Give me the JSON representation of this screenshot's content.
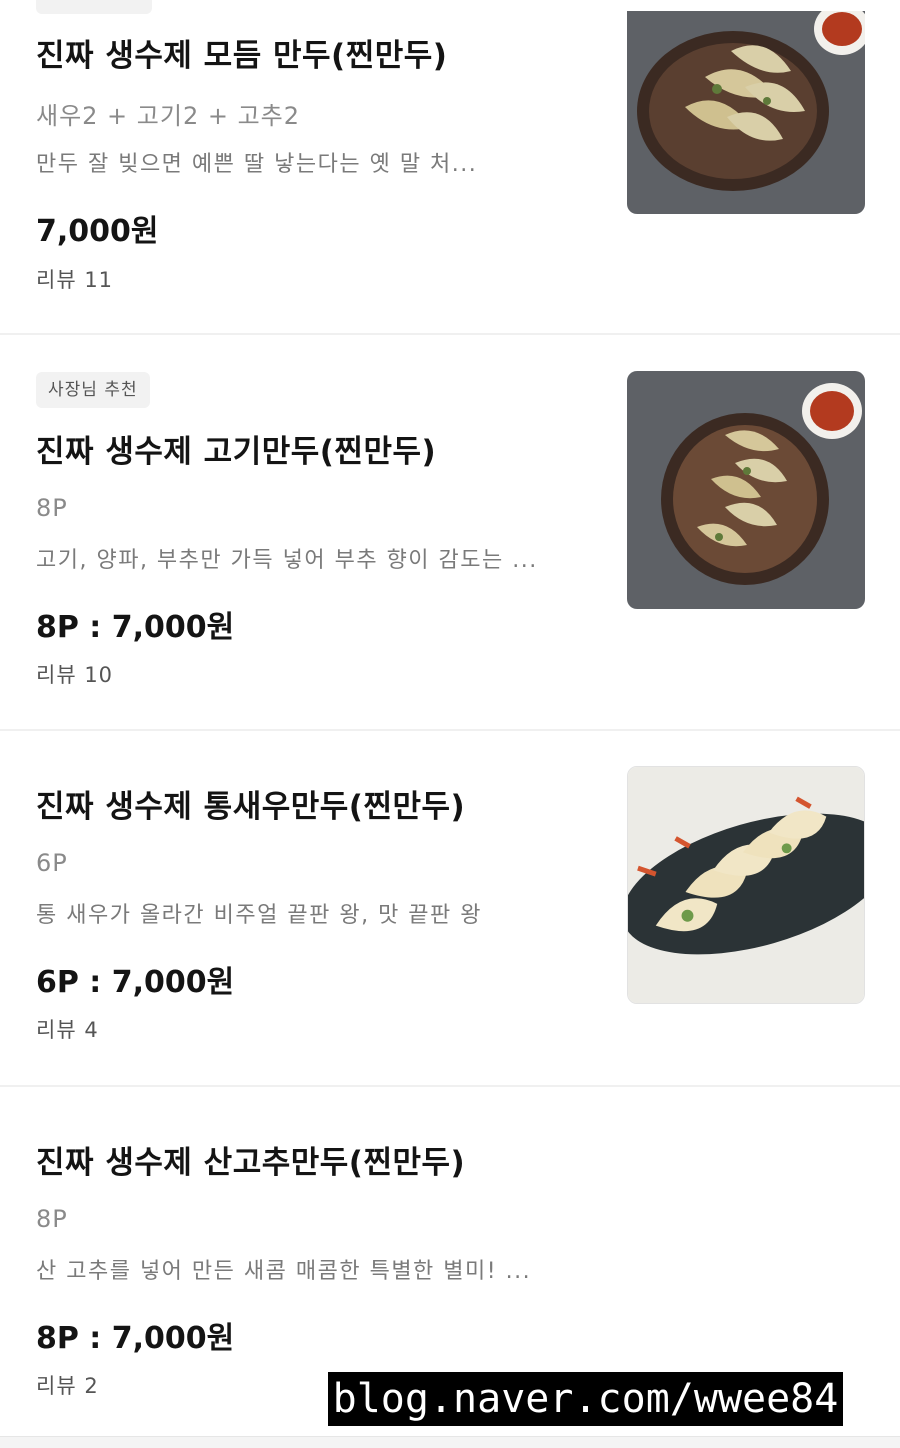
{
  "items": [
    {
      "badge": "",
      "title": "진짜 생수제 모듬 만두(찐만두)",
      "sub": "새우2 + 고기2 + 고추2",
      "desc": "만두 잘 빚으면 예쁜 딸 낳는다는 옛 말 처...",
      "price": "7,000원",
      "review": "리뷰 11",
      "image": "steamed-dumplings-plate-icon"
    },
    {
      "badge": "사장님 추천",
      "title": "진짜 생수제 고기만두(찐만두)",
      "sub": "8P",
      "desc": "고기, 양파, 부추만 가득 넣어 부추 향이 감도는 ...",
      "price": "8P : 7,000원",
      "review": "리뷰 10",
      "image": "steamed-dumplings-plate-icon"
    },
    {
      "badge": "",
      "title": "진짜 생수제 통새우만두(찐만두)",
      "sub": "6P",
      "desc": "통 새우가 올라간 비주얼 끝판 왕, 맛 끝판 왕",
      "price": "6P : 7,000원",
      "review": "리뷰 4",
      "image": "shrimp-dumplings-plate-icon"
    },
    {
      "badge": "",
      "title": "진짜 생수제 산고추만두(찐만두)",
      "sub": "8P",
      "desc": "산 고추를 넣어 만든 새콤 매콤한 특별한 별미! ...",
      "price": "8P : 7,000원",
      "review": "리뷰 2",
      "image": ""
    }
  ],
  "watermark": "blog.naver.com/wwee84",
  "colors": {
    "badge_bg": "#f2f2f2",
    "divider": "#f0f0f0",
    "text_main": "#141414",
    "text_sub": "#8a8a8a"
  }
}
